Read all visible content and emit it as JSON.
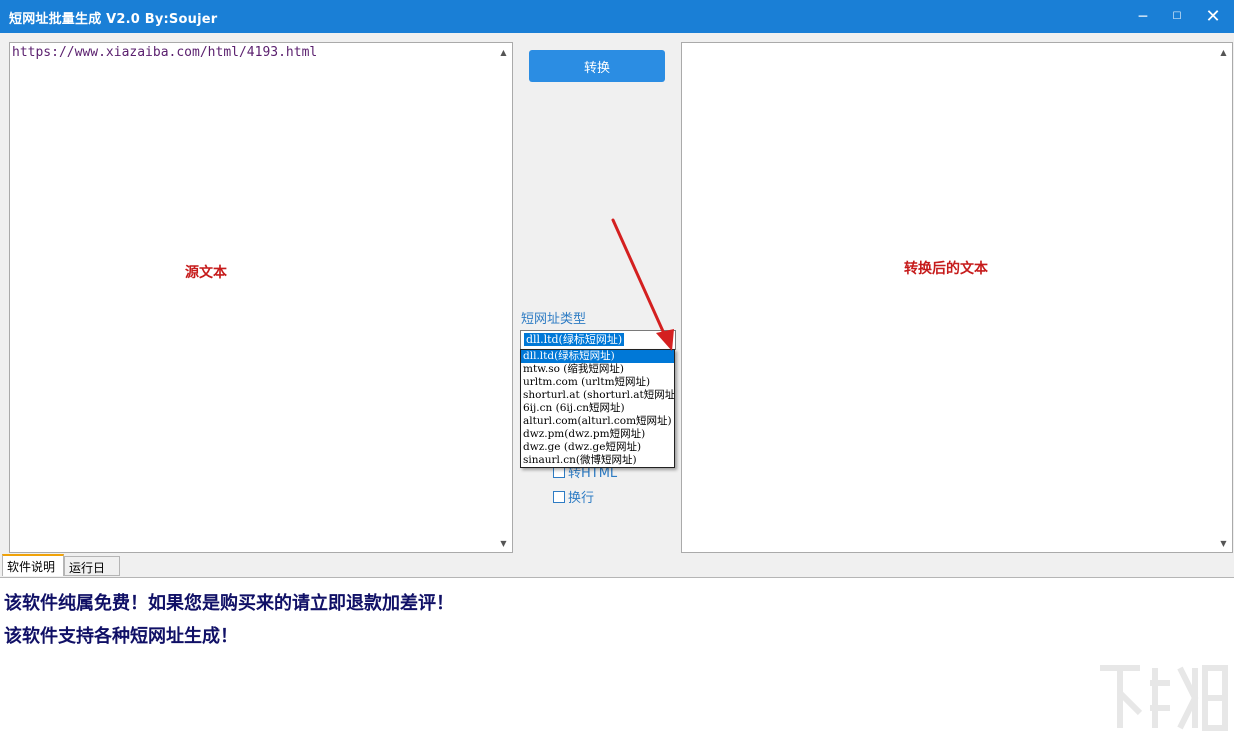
{
  "window": {
    "title": "短网址批量生成    V2.0 By:Soujer",
    "minimize_label": "─",
    "maximize_label": "☐",
    "close_label": "✕"
  },
  "source": {
    "text": "https://www.xiazaiba.com/html/4193.html",
    "center_label": "源文本"
  },
  "output": {
    "center_label": "转换后的文本"
  },
  "convert_button": "转换",
  "short_url_type": {
    "label": "短网址类型",
    "selected": "dll.ltd(绿标短网址)",
    "options": [
      "dll.ltd(绿标短网址)",
      "mtw.so (缩我短网址)",
      "urltm.com (urltm短网址)",
      "shorturl.at (shorturl.at短网址)",
      "6ij.cn (6ij.cn短网址)",
      "alturl.com(alturl.com短网址)",
      "dwz.pm(dwz.pm短网址)",
      "dwz.ge (dwz.ge短网址)",
      "sinaurl.cn(微博短网址)"
    ]
  },
  "checkboxes": [
    {
      "label": "转HTML",
      "checked": false
    },
    {
      "label": "换行",
      "checked": false
    }
  ],
  "tabs": [
    {
      "label": "软件说明",
      "active": true
    },
    {
      "label": "运行日志",
      "active": false
    }
  ],
  "info_lines": [
    "该软件纯属免费！如果您是购买来的请立即退款加差评！",
    "该软件支持各种短网址生成！"
  ],
  "colors": {
    "titlebar": "#1a7fd6",
    "convert_button": "#2b8de3",
    "label_red": "#c61b1b",
    "info_text": "#101066",
    "selection": "#0078d7"
  }
}
